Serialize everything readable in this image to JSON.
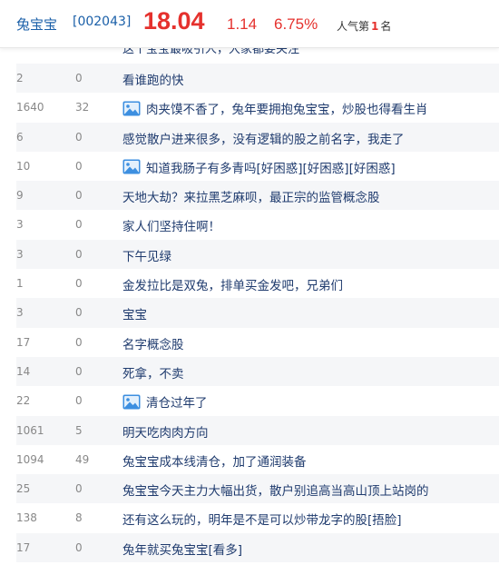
{
  "header": {
    "stock_name": "兔宝宝",
    "stock_code": "[002043]",
    "price": "18.04",
    "change": "1.14",
    "change_pct": "6.75%",
    "popularity_prefix": "人气第",
    "popularity_rank": "1",
    "popularity_suffix": "名"
  },
  "partial_row_title": "这个宝宝最吸引人，大家都要关注",
  "posts": [
    {
      "reads": "2",
      "replies": "0",
      "title": "看谁跑的快",
      "has_image": false
    },
    {
      "reads": "1640",
      "replies": "32",
      "title": "肉夹馍不香了，兔年要拥抱兔宝宝，炒股也得看生肖",
      "has_image": true
    },
    {
      "reads": "6",
      "replies": "0",
      "title": "感觉散户进来很多，没有逻辑的股之前名字，我走了",
      "has_image": false
    },
    {
      "reads": "10",
      "replies": "0",
      "title": "知道我肠子有多青吗[好困惑][好困惑][好困惑]",
      "has_image": true
    },
    {
      "reads": "9",
      "replies": "0",
      "title": "天地大劫？来拉黑芝麻呗，最正宗的监管概念股",
      "has_image": false
    },
    {
      "reads": "3",
      "replies": "0",
      "title": "家人们坚持住啊！",
      "has_image": false
    },
    {
      "reads": "3",
      "replies": "0",
      "title": "下午见绿",
      "has_image": false
    },
    {
      "reads": "1",
      "replies": "0",
      "title": "金发拉比是双兔，排单买金发吧，兄弟们",
      "has_image": false
    },
    {
      "reads": "3",
      "replies": "0",
      "title": "宝宝",
      "has_image": false
    },
    {
      "reads": "17",
      "replies": "0",
      "title": "名字概念股",
      "has_image": false
    },
    {
      "reads": "14",
      "replies": "0",
      "title": "死拿，不卖",
      "has_image": false
    },
    {
      "reads": "22",
      "replies": "0",
      "title": "清仓过年了",
      "has_image": true
    },
    {
      "reads": "1061",
      "replies": "5",
      "title": "明天吃肉肉方向",
      "has_image": false
    },
    {
      "reads": "1094",
      "replies": "49",
      "title": "兔宝宝成本线清仓，加了通润装备",
      "has_image": false
    },
    {
      "reads": "25",
      "replies": "0",
      "title": "兔宝宝今天主力大幅出货，散户别追高当高山顶上站岗的",
      "has_image": false
    },
    {
      "reads": "138",
      "replies": "8",
      "title": "还有这么玩的，明年是不是可以炒带龙字的股[捂脸]",
      "has_image": false
    },
    {
      "reads": "17",
      "replies": "0",
      "title": "兔年就买兔宝宝[看多]",
      "has_image": false
    }
  ],
  "colors": {
    "price_red": "#e5312d",
    "link_blue": "#1a5fa8",
    "title_navy": "#1f3b6e",
    "stripe": "#f5f6f8"
  },
  "icons": {
    "post_image": "image-icon"
  }
}
